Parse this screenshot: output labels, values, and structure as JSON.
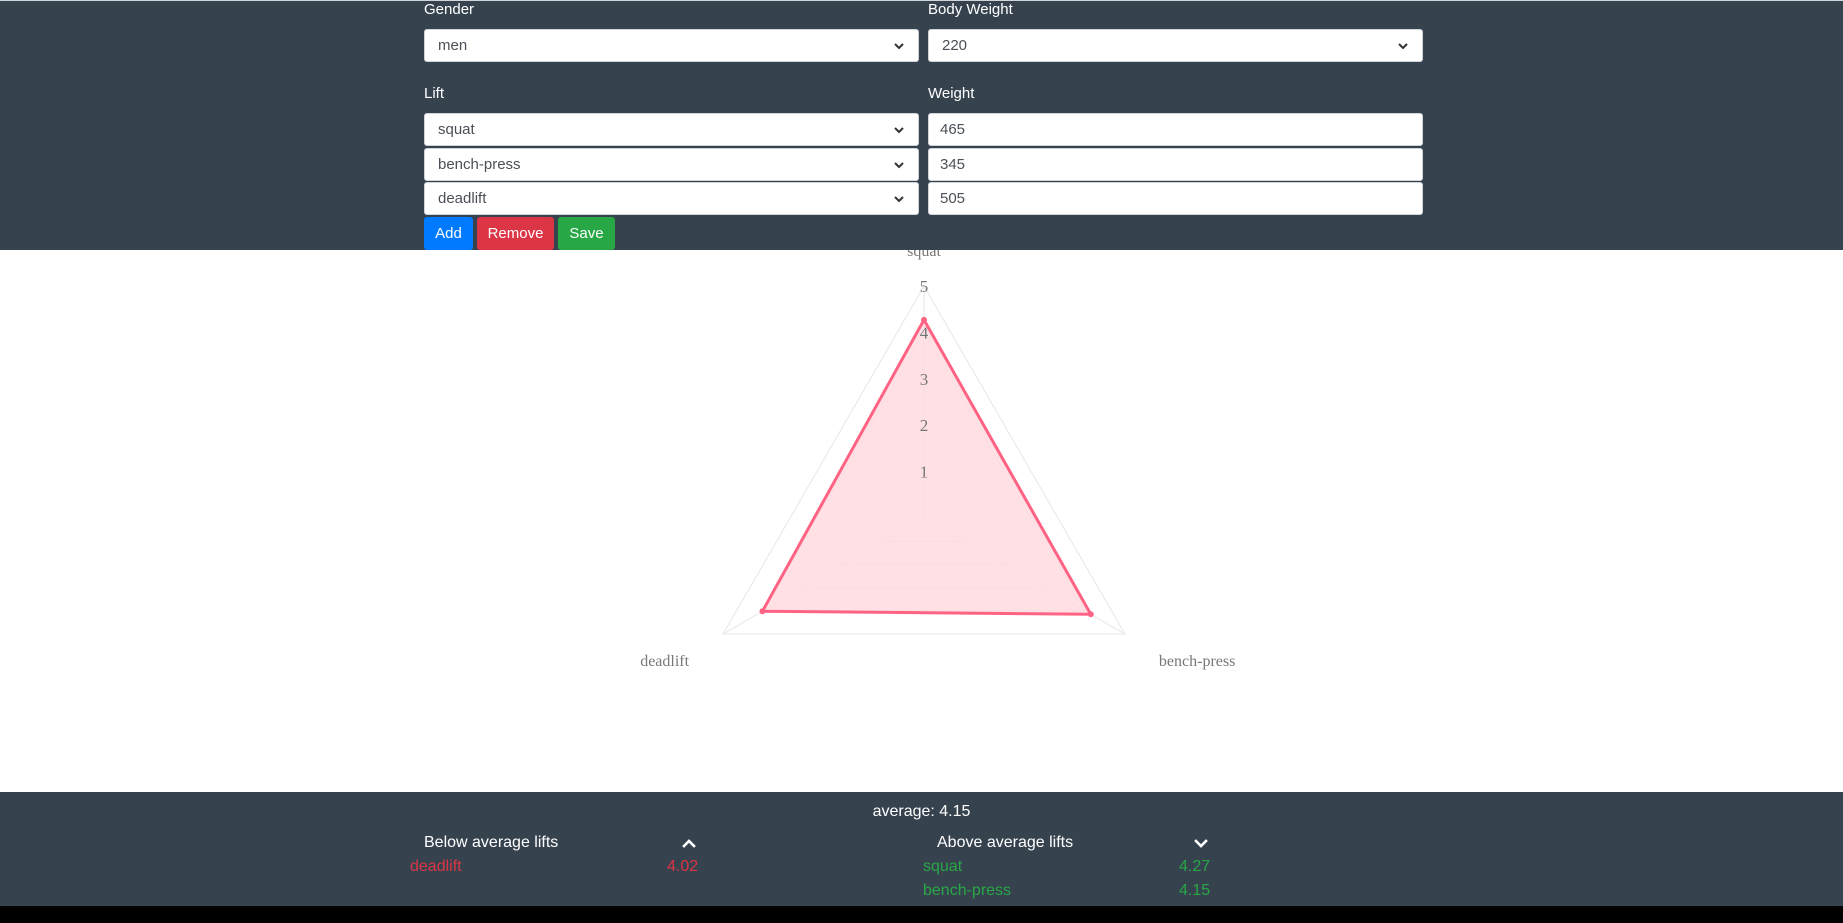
{
  "form": {
    "gender_label": "Gender",
    "gender_value": "men",
    "bodyweight_label": "Body Weight",
    "bodyweight_value": "220",
    "lift_label": "Lift",
    "weight_label": "Weight",
    "lifts": [
      {
        "lift": "squat",
        "weight": "465"
      },
      {
        "lift": "bench-press",
        "weight": "345"
      },
      {
        "lift": "deadlift",
        "weight": "505"
      }
    ],
    "add_label": "Add",
    "remove_label": "Remove",
    "save_label": "Save"
  },
  "chart_data": {
    "type": "radar",
    "axes": [
      "squat",
      "bench-press",
      "deadlift"
    ],
    "values": [
      4.27,
      4.15,
      4.02
    ],
    "rmin": 0,
    "rmax": 5,
    "ticks": [
      "1",
      "2",
      "3",
      "4",
      "5"
    ],
    "grid": true,
    "line_color": "#ff6384",
    "fill_color": "#ffdbe1"
  },
  "summary": {
    "average_text": "average: 4.15",
    "below_title": "Below average lifts",
    "above_title": "Above average lifts",
    "below": [
      {
        "name": "deadlift",
        "score": "4.02"
      }
    ],
    "above": [
      {
        "name": "squat",
        "score": "4.27"
      },
      {
        "name": "bench-press",
        "score": "4.15"
      }
    ]
  },
  "icons": {
    "chevron_down": "chevron-down-icon",
    "chevron_up": "chevron-up-icon"
  }
}
